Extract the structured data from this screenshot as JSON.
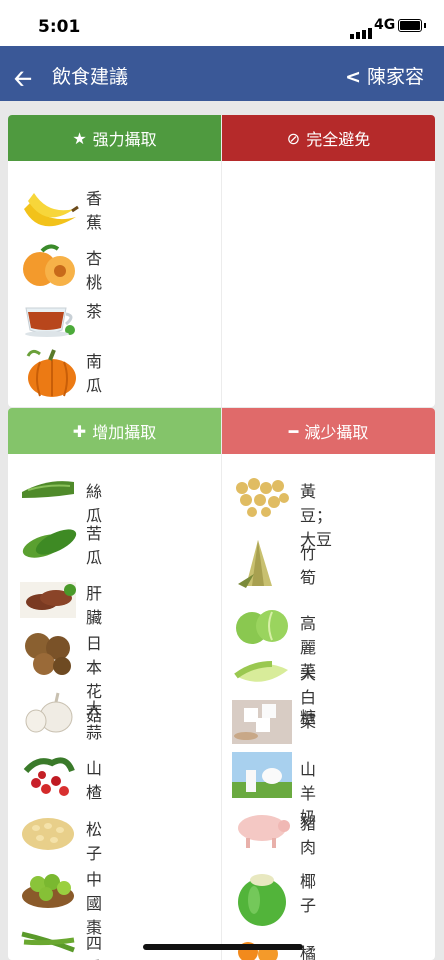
{
  "status_bar": {
    "time": "5:01",
    "network": "4G"
  },
  "nav": {
    "title": "飲食建議",
    "user": "陳家容"
  },
  "sections": {
    "strong": {
      "label": "强力攝取",
      "color": "#4f9a3f"
    },
    "avoid": {
      "label": "完全避免",
      "color": "#b52a2a"
    },
    "increase": {
      "label": "增加攝取",
      "color": "#84c46a"
    },
    "decrease": {
      "label": "減少攝取",
      "color": "#e06a6a"
    }
  },
  "strong_items": [
    "香蕉",
    "杏桃",
    "茶",
    "南瓜"
  ],
  "increase_items": [
    "絲瓜",
    "苦瓜",
    "肝臟",
    "日本花菇",
    "大蒜",
    "山楂",
    "松子",
    "中國棗",
    "四季豆"
  ],
  "decrease_items": [
    "黃豆；大豆",
    "竹筍",
    "高麗菜",
    "大白菜",
    "糖",
    "山羊奶",
    "豬肉",
    "椰子",
    "橘子"
  ]
}
